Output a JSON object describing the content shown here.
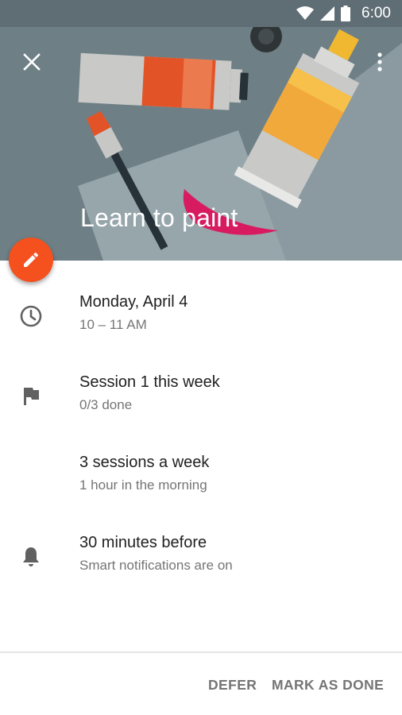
{
  "status_bar": {
    "time": "6:00",
    "icons": [
      "wifi-icon",
      "signal-icon",
      "battery-icon"
    ]
  },
  "header": {
    "title": "Learn to paint",
    "close_icon": "close-icon",
    "more_icon": "more-vert-icon"
  },
  "fab": {
    "icon": "edit-pencil-icon",
    "color": "#f4511e"
  },
  "details": [
    {
      "icon": "clock-icon",
      "primary": "Monday, April 4",
      "secondary": "10 – 11 AM"
    },
    {
      "icon": "flag-icon",
      "primary": "Session 1 this week",
      "secondary": "0/3 done"
    },
    {
      "icon": "",
      "primary": "3 sessions a week",
      "secondary": "1 hour in the morning"
    },
    {
      "icon": "bell-icon",
      "primary": "30 minutes before",
      "secondary": "Smart notifications are on"
    }
  ],
  "actions": {
    "defer_label": "DEFER",
    "mark_done_label": "MARK AS DONE"
  },
  "colors": {
    "status_bar": "#5f6e74",
    "hero_background": "#6e7f86",
    "accent": "#f4511e",
    "primary_text": "#212121",
    "secondary_text": "#757575"
  }
}
